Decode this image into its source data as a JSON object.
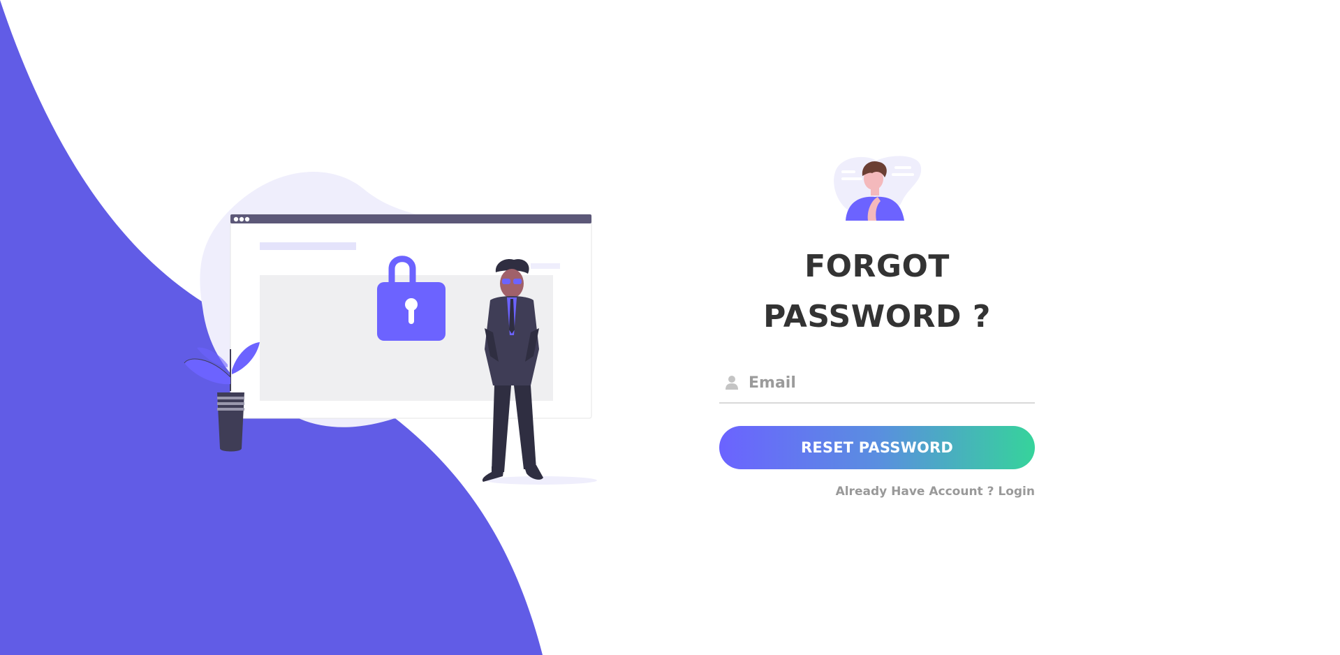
{
  "theme": {
    "accent": "#615ce6",
    "illustration_accent": "#6c63ff",
    "button_gradient_start": "#6b63ff",
    "button_gradient_end": "#36d39b",
    "title_color": "#333333",
    "muted_text": "#999999"
  },
  "form": {
    "title_line1": "FORGOT",
    "title_line2": "PASSWORD ?",
    "email_placeholder": "Email",
    "email_value": "",
    "email_icon": "user-icon",
    "submit_label": "RESET PASSWORD",
    "account_prompt": "Already Have Account ?",
    "login_link": "Login"
  },
  "illustration": {
    "lock_icon": "padlock-icon",
    "figure": "man-in-suit",
    "plant": "potted-plant"
  }
}
